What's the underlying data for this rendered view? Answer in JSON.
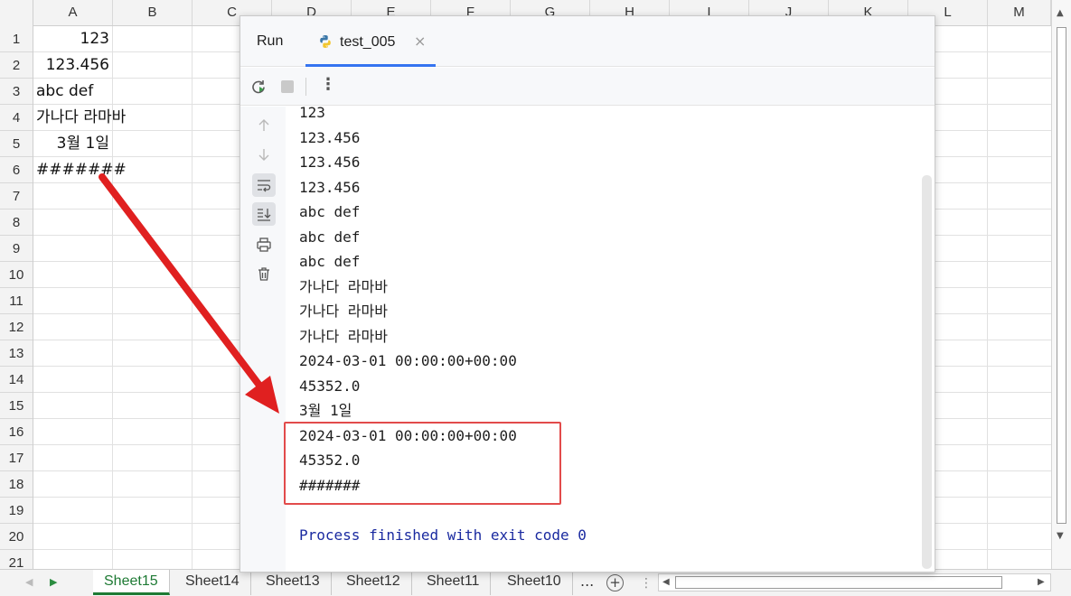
{
  "sheet": {
    "columns": [
      "A",
      "B",
      "C",
      "D",
      "E",
      "F",
      "G",
      "H",
      "I",
      "J",
      "K",
      "L",
      "M"
    ],
    "rows": [
      "1",
      "2",
      "3",
      "4",
      "5",
      "6",
      "7",
      "8",
      "9",
      "10",
      "11",
      "12",
      "13",
      "14",
      "15",
      "16",
      "17",
      "18",
      "19",
      "20",
      "21"
    ],
    "cells": {
      "a1": "123",
      "a2": "123.456",
      "a3": "abc def",
      "a4": "가나다 라마바",
      "a5": "3월 1일",
      "a6": "#######"
    },
    "tabs": [
      "Sheet15",
      "Sheet14",
      "Sheet13",
      "Sheet12",
      "Sheet11",
      "Sheet10"
    ],
    "active_tab": "Sheet15",
    "more": "...",
    "add": "+"
  },
  "run": {
    "title": "Run",
    "tab_label": "test_005",
    "close": "×",
    "output": [
      "123",
      "123.456",
      "123.456",
      "123.456",
      "abc def",
      "abc def",
      "abc def",
      "가나다 라마바",
      "가나다 라마바",
      "가나다 라마바",
      "2024-03-01 00:00:00+00:00",
      "45352.0",
      "3월 1일",
      "2024-03-01 00:00:00+00:00",
      "45352.0",
      "#######"
    ],
    "exit_message": "Process finished with exit code 0"
  },
  "icons": {
    "rerun": "rerun-icon",
    "stop": "stop-icon",
    "more": "more-vertical-icon",
    "up": "arrow-up-icon",
    "down": "arrow-down-icon",
    "wrap": "soft-wrap-icon",
    "scroll_end": "scroll-to-end-icon",
    "print": "print-icon",
    "trash": "trash-icon",
    "python": "python-icon"
  },
  "colors": {
    "excel_green": "#1e7a34",
    "accent_blue": "#3574f0",
    "annotation_red": "#e02020",
    "exit_text": "#1a2aa0"
  }
}
